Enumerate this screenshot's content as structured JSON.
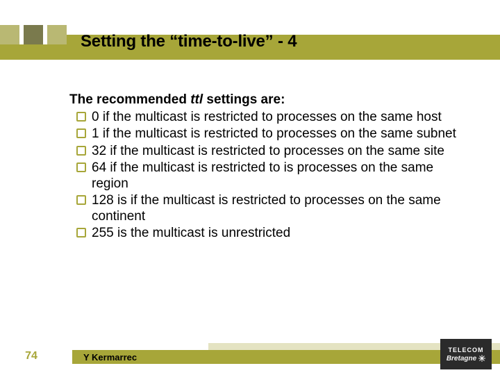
{
  "title": "Setting the “time-to-live” - 4",
  "intro_prefix": "The recommended ",
  "intro_em": "ttl",
  "intro_suffix": " settings are:",
  "bullets": [
    {
      "num": "0",
      "text": " if the multicast is restricted to processes on the same host"
    },
    {
      "num": "1",
      "text": " if the multicast is restricted to processes on the same subnet"
    },
    {
      "num": "32",
      "text": " if the multicast is restricted to processes on the same site"
    },
    {
      "num": "64",
      "text": " if the multicast is restricted to is processes on the same region"
    },
    {
      "num": "128",
      "text": " is if the multicast is restricted to processes on the same continent"
    },
    {
      "num": "255",
      "text": " is the multicast is unrestricted"
    }
  ],
  "page_number": "74",
  "author": "Y Kermarrec",
  "logo": {
    "line1": "TELECOM",
    "line2": "Bretagne"
  }
}
